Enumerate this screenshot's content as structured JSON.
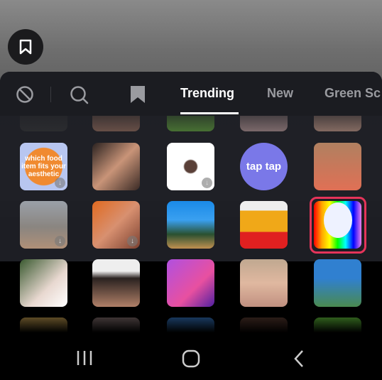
{
  "tabs": [
    {
      "label": "Trending",
      "active": true
    },
    {
      "label": "New"
    },
    {
      "label": "Green Sc"
    }
  ],
  "icons": {
    "bookmark_button": "bookmark-icon",
    "none": "no-effect-icon",
    "search": "search-icon",
    "favorites": "bookmark-icon"
  },
  "effects": {
    "row0": [
      "partial",
      "partial",
      "partial",
      "partial",
      "partial"
    ],
    "row1": [
      {
        "text": "which food item fits your aesthetic"
      },
      {
        "text": ""
      },
      {
        "text": ""
      },
      {
        "text": "tap tap"
      },
      {
        "text": ""
      }
    ],
    "selected": "rainbow-balloon"
  },
  "colors": {
    "accent": "#e5345a",
    "panel": "#1e1f25"
  },
  "nav": [
    "recent-apps",
    "home",
    "back"
  ]
}
